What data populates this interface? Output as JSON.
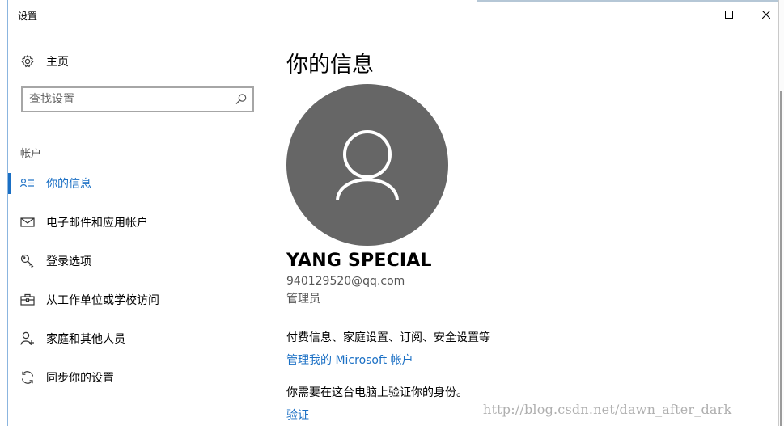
{
  "window": {
    "title": "设置",
    "buttons": {
      "minimize": "minimize-icon",
      "maximize": "maximize-icon",
      "close": "close-icon"
    }
  },
  "sidebar": {
    "home": {
      "label": "主页",
      "icon": "gear-icon"
    },
    "search": {
      "placeholder": "查找设置",
      "value": "",
      "icon": "search-icon"
    },
    "section_label": "帐户",
    "items": [
      {
        "label": "你的信息",
        "icon": "user-info-icon",
        "active": true
      },
      {
        "label": "电子邮件和应用帐户",
        "icon": "mail-icon",
        "active": false
      },
      {
        "label": "登录选项",
        "icon": "key-icon",
        "active": false
      },
      {
        "label": "从工作单位或学校访问",
        "icon": "briefcase-icon",
        "active": false
      },
      {
        "label": "家庭和其他人员",
        "icon": "add-person-icon",
        "active": false
      },
      {
        "label": "同步你的设置",
        "icon": "sync-icon",
        "active": false
      }
    ]
  },
  "main": {
    "title": "你的信息",
    "avatar_icon": "user-avatar-icon",
    "user_name": "YANG SPECIAL",
    "email": "940129520@qq.com",
    "role": "管理员",
    "billing_text": "付费信息、家庭设置、订阅、安全设置等",
    "manage_link": "管理我的 Microsoft 帐户",
    "verify_text": "你需要在这台电脑上验证你的身份。",
    "verify_link": "验证"
  },
  "watermark": "http://blog.csdn.net/dawn_after_dark",
  "colors": {
    "accent": "#1a6fc4",
    "avatar_bg": "#666666",
    "secondary_text": "#555555"
  }
}
